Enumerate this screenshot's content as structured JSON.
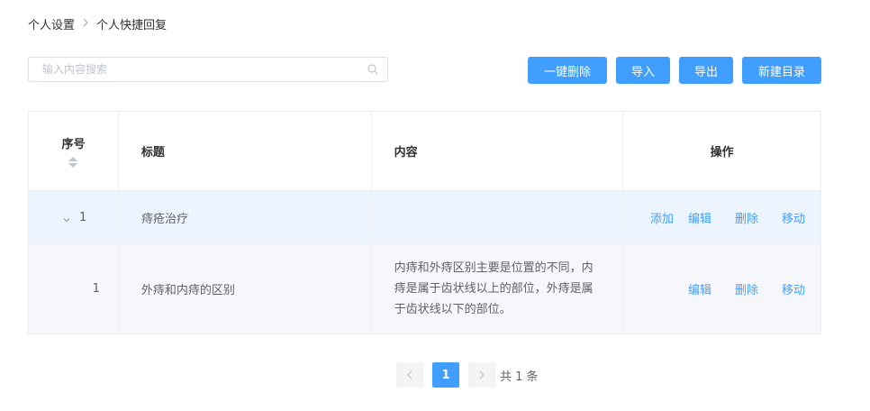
{
  "breadcrumb": {
    "parent": "个人设置",
    "current": "个人快捷回复"
  },
  "search": {
    "placeholder": "输入内容搜索"
  },
  "toolbar": {
    "delete_all": "一键删除",
    "import": "导入",
    "export": "导出",
    "new_dir": "新建目录"
  },
  "table": {
    "headers": {
      "index": "序号",
      "title": "标题",
      "content": "内容",
      "actions": "操作"
    },
    "rows": [
      {
        "index": "1",
        "title": "痔疮治疗",
        "content": "",
        "actions": [
          "添加",
          "编辑",
          "删除",
          "移动"
        ]
      },
      {
        "index": "1",
        "title": "外痔和内痔的区别",
        "content": "内痔和外痔区别主要是位置的不同，内痔是属于齿状线以上的部位，外痔是属于齿状线以下的部位。",
        "actions": [
          "编辑",
          "删除",
          "移动"
        ]
      }
    ]
  },
  "pagination": {
    "current_page": "1",
    "total": "共 1 条"
  },
  "colors": {
    "primary": "#409eff",
    "row_highlight": "#ecf5ff",
    "row_alt": "#f5f7fa"
  },
  "icons": [
    "chevron-right-icon",
    "search-icon",
    "sort-icon",
    "chevron-down-icon",
    "chevron-left-icon"
  ]
}
